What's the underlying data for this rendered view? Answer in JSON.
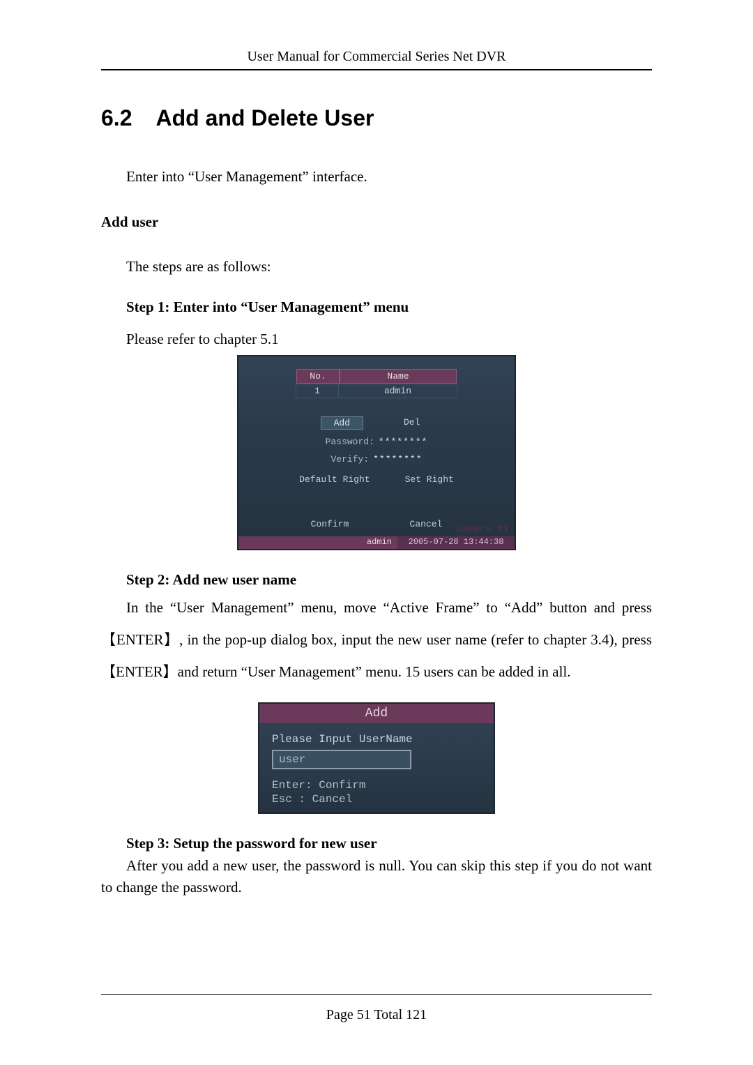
{
  "header": {
    "title": "User Manual for Commercial Series Net DVR"
  },
  "section": {
    "number": "6.2",
    "title": "Add and Delete User"
  },
  "intro": "Enter into “User Management” interface.",
  "add_user_heading": "Add user",
  "steps_intro": "The steps are as follows:",
  "step1": {
    "heading": "Step 1: Enter into “User Management” menu",
    "line": "Please refer to chapter 5.1"
  },
  "dvr": {
    "columns": {
      "no": "No.",
      "name": "Name"
    },
    "row": {
      "no": "1",
      "name": "admin"
    },
    "add_label": "Add",
    "del_label": "Del",
    "password_label": "Password:",
    "password_value": "********",
    "verify_label": "Verify:",
    "verify_value": "********",
    "default_right": "Default Right",
    "set_right": "Set Right",
    "confirm": "Confirm",
    "cancel": "Cancel",
    "camera": "Camera 01",
    "status_user": "admin",
    "status_time": "2005-07-28 13:44:38"
  },
  "step2": {
    "heading": "Step 2: Add new user name",
    "body": "In the “User Management” menu, move “Active Frame” to “Add” button and press 【ENTER】, in the pop-up dialog box, input the new user name (refer to chapter 3.4), press 【ENTER】and return “User Management” menu. 15 users can be added in all."
  },
  "dialog": {
    "title": "Add",
    "prompt": "Please Input UserName",
    "input_value": "user",
    "hint_enter": "Enter: Confirm",
    "hint_esc": "Esc    : Cancel"
  },
  "step3": {
    "heading": "Step 3: Setup the password for new user",
    "body": "After you add a new user, the password is null. You can skip this step if you do not want to change the password."
  },
  "footer": {
    "page_label": "Page",
    "page_num": "51",
    "total_label": "Total",
    "total_num": "121"
  }
}
